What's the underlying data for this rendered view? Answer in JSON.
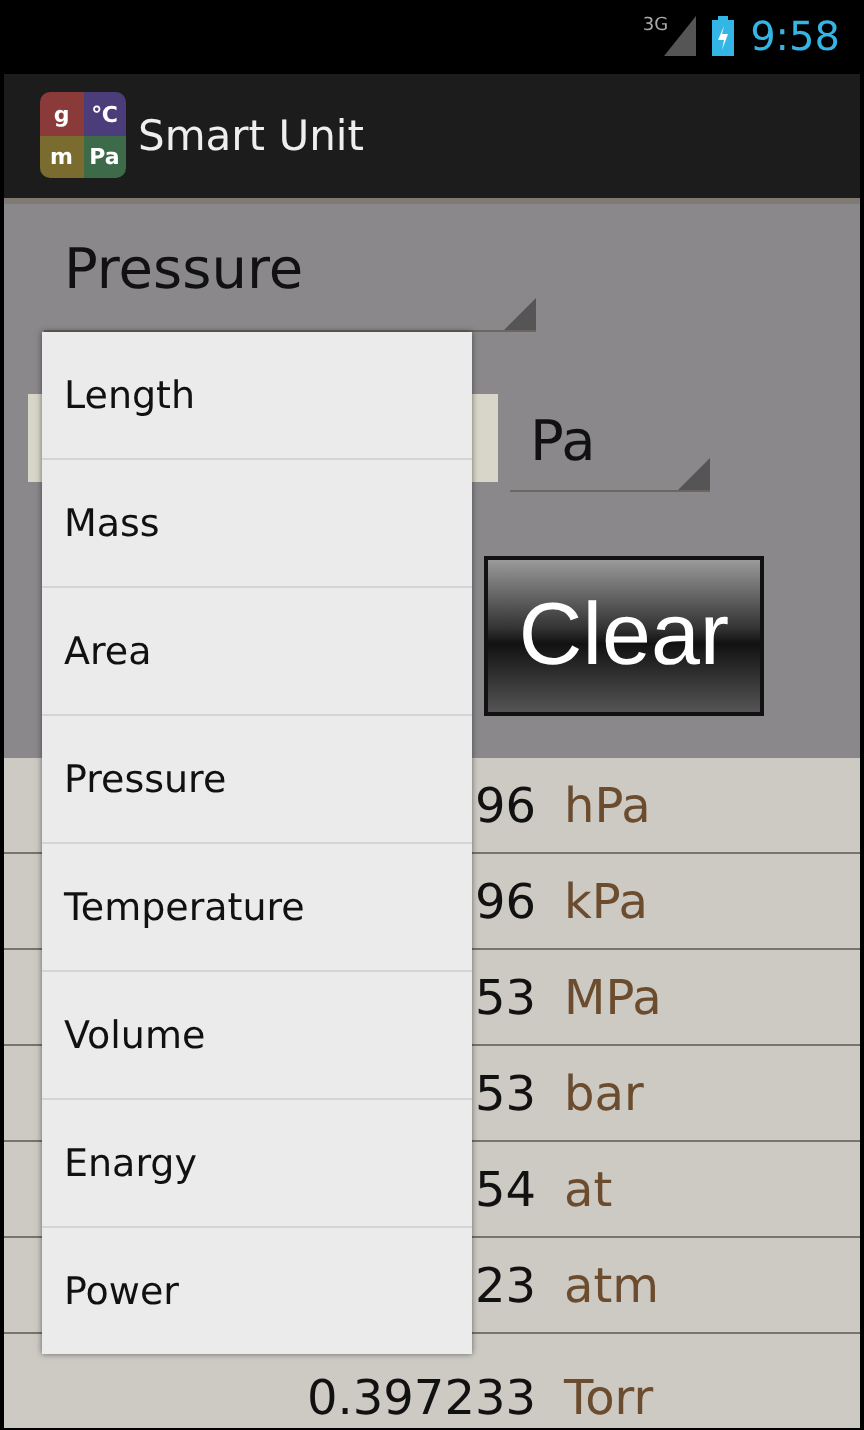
{
  "status_bar": {
    "network": "3G",
    "time": "9:58"
  },
  "action_bar": {
    "logo": [
      "g",
      "℃",
      "m",
      "Pa"
    ],
    "title": "Smart Unit"
  },
  "category_spinner": {
    "value": "Pressure"
  },
  "unit_spinner": {
    "value": "Pa"
  },
  "clear_button": {
    "label": "Clear"
  },
  "results": [
    {
      "value": "96",
      "unit": "hPa"
    },
    {
      "value": "96",
      "unit": "kPa"
    },
    {
      "value": "53",
      "unit": "MPa"
    },
    {
      "value": "53",
      "unit": "bar"
    },
    {
      "value": "54",
      "unit": "at"
    },
    {
      "value": "23",
      "unit": "atm"
    },
    {
      "value": "0.397233",
      "unit": "Torr"
    }
  ],
  "dropdown": {
    "items": [
      {
        "label": "Length"
      },
      {
        "label": "Mass"
      },
      {
        "label": "Area"
      },
      {
        "label": "Pressure"
      },
      {
        "label": "Temperature"
      },
      {
        "label": "Volume"
      },
      {
        "label": "Enargy"
      },
      {
        "label": "Power"
      }
    ]
  }
}
